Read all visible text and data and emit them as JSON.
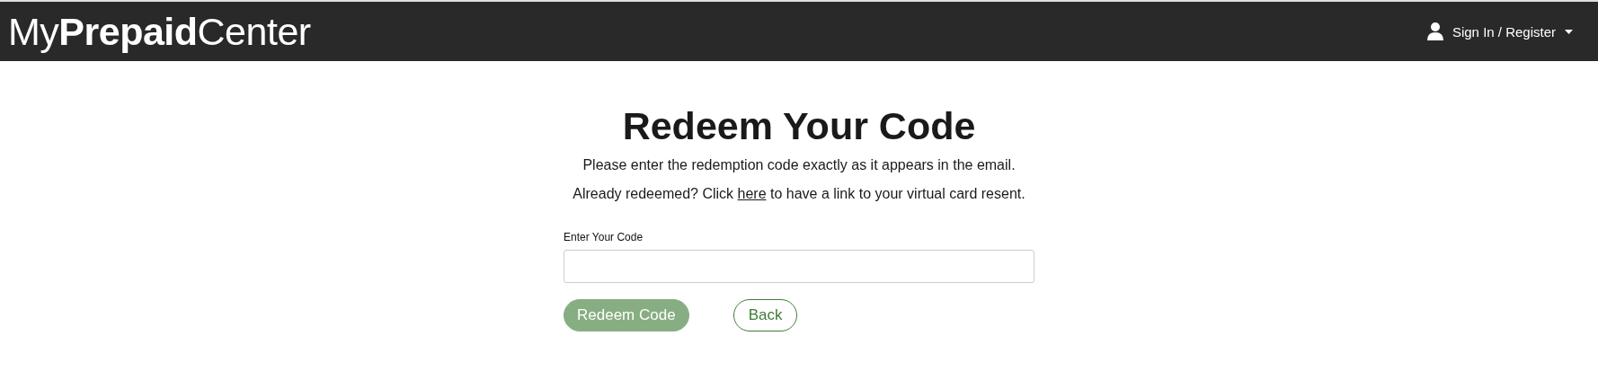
{
  "header": {
    "logo": "My**Prepaid**Center",
    "account_menu": {
      "label": "Sign In / Register",
      "expanded": false
    }
  },
  "main": {
    "title": "Redeem Your Code",
    "instructions": "Please enter the redemption code exactly as it appears in the email.",
    "resend_before": "Already redeemed? Click",
    "resend_link": "here",
    "resend_after": "to have a link to your virtual card resent.",
    "code_field": {
      "label": "Enter Your Code"
    },
    "buttons": [
      {
        "kind": "primary",
        "label": "Redeem Code",
        "disabled": true
      },
      {
        "kind": "outline",
        "label": "Back",
        "disabled": false
      }
    ]
  }
}
